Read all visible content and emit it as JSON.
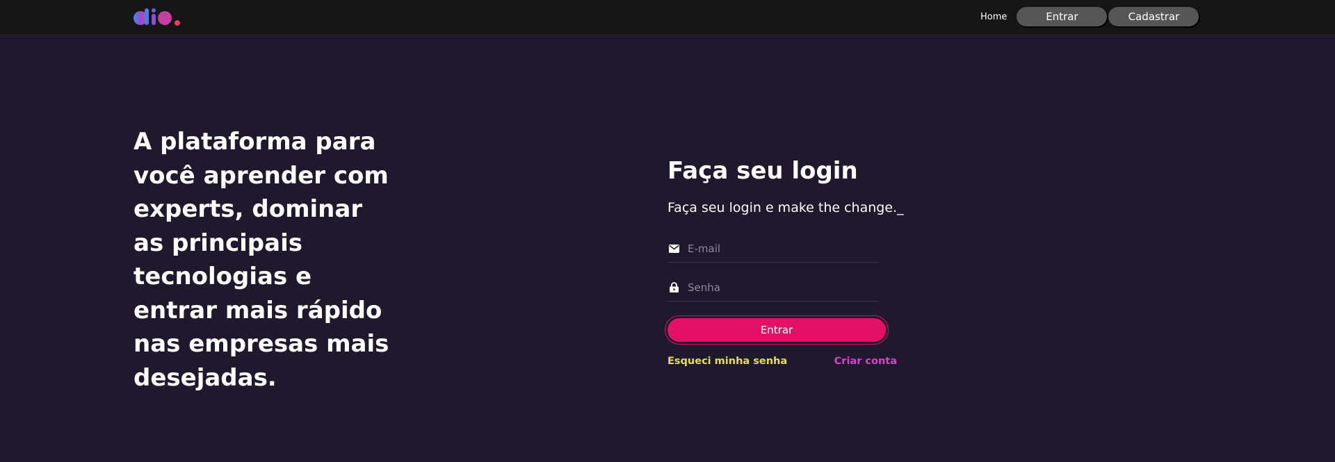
{
  "header": {
    "logo_icon": "dio-logo-icon",
    "nav": {
      "home_label": "Home",
      "login_label": "Entrar",
      "signup_label": "Cadastrar"
    }
  },
  "hero": {
    "headline": "A plataforma para você aprender com experts, dominar as principais tecnologias e entrar mais rápido nas empresas mais desejadas."
  },
  "login": {
    "title": "Faça seu login",
    "subtitle": "Faça seu login e make the change._",
    "email": {
      "icon": "mail-icon",
      "placeholder": "E-mail",
      "value": ""
    },
    "password": {
      "icon": "lock-icon",
      "placeholder": "Senha",
      "value": ""
    },
    "submit_label": "Entrar",
    "forgot_label": "Esqueci minha senha",
    "create_label": "Criar conta"
  },
  "colors": {
    "background": "#1e192c",
    "topbar": "#151515",
    "accent": "#e41065",
    "forgot_link": "#e5e044",
    "create_link": "#e23dd0",
    "nav_button": "#565656"
  }
}
